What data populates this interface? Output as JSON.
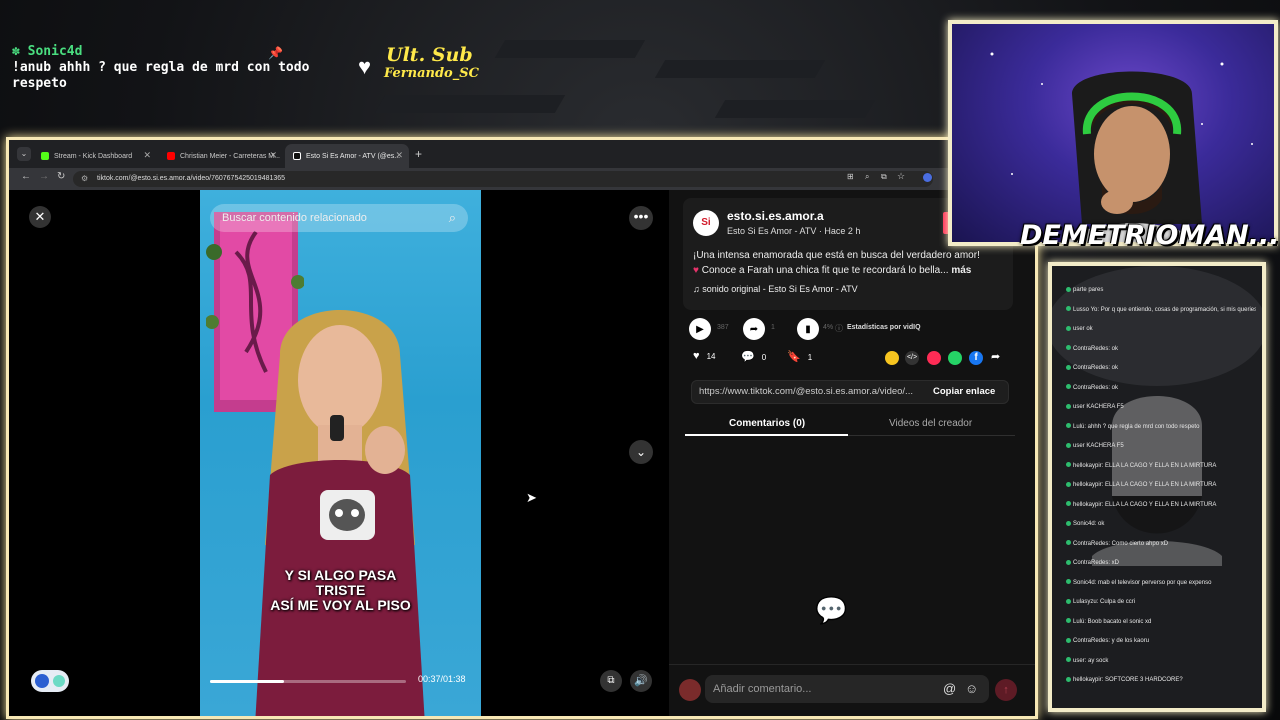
{
  "overlay": {
    "chat": {
      "user": "Sonic4d",
      "message": "!anub ahhh ? que regla de mrd con todo\nrespeto"
    },
    "ult_sub": {
      "title": "Ult. Sub",
      "name": "Fernando_SC"
    },
    "streamer_name": "DEMETRIOMAN...",
    "colors": {
      "frame": "#f3ecc8",
      "chat_user": "#4ade80",
      "ult_sub": "#ffe94a"
    }
  },
  "browser": {
    "tabs": [
      {
        "title": "Stream - Kick Dashboard",
        "icon_color": "#53fc18"
      },
      {
        "title": "Christian Meier - Carreteras M...",
        "icon_color": "#ff0000"
      },
      {
        "title": "Esto Si Es Amor - ATV (@es...",
        "icon_color": "#ffffff"
      }
    ],
    "url": "tiktok.com/@esto.si.es.amor.a/video/7607675425019481365"
  },
  "video": {
    "search_placeholder": "Buscar contenido relacionado",
    "caption_lines": [
      "Y SI ALGO PASA",
      "TRISTE",
      "ASÍ ME VOY AL PISO"
    ],
    "time": "00:37/01:38",
    "progress": 0.38
  },
  "post": {
    "username": "esto.si.es.amor.a",
    "subtitle": "Esto Si Es Amor - ATV · Hace 2 h",
    "avatar_text": "Si",
    "description_line1": "¡Una intensa enamorada que está en busca del verdadero amor!",
    "description_line2": "Conoce a Farah una chica fit que te recordará lo bella...",
    "more": "más",
    "sound": "sonido original - Esto Si Es Amor - ATV",
    "stat_play": "387",
    "stat_share": "1",
    "stat_pct": "4%",
    "stats_label": "Estadísticas por vidIQ",
    "likes": "14",
    "comments": "0",
    "saves": "1",
    "link_url": "https://www.tiktok.com/@esto.si.es.amor.a/video/...",
    "copy_link": "Copiar enlace",
    "tab_comments": "Comentarios (0)",
    "tab_videos": "Videos del creador",
    "comment_placeholder": "Añadir comentario..."
  },
  "right_chat": {
    "lines": [
      "parte pares",
      "Lusso Yo: Por q que entiendo, cosas de programación, si mis queries se producción no se deciden por Iber?",
      "user ok",
      "ContraRedes: ok",
      "ContraRedes: ok",
      "ContraRedes: ok",
      "user KACHERA F5",
      "Lulú: ahhh ? que regla de mrd con todo respeto",
      "user KACHERA F5",
      "hellokaypir: ELLA LA CAGO Y ELLA EN LA MIRTURA",
      "hellokaypir: ELLA LA CAGO Y ELLA EN LA MIRTURA",
      "hellokaypir: ELLA LA CAGO Y ELLA EN LA MIRTURA",
      "Sonic4d: ok",
      "ContraRedes: Como cierto ahpo xD",
      "ContraRedes: xD",
      "Sonic4d: mab el televisor perverso por que expenso",
      "Lulasyzu: Culpa de ccri",
      "Lulú: Boob bacato el sonic xd",
      "ContraRedes: y de los kaoru",
      "user: ay sock",
      "hellokaypir: SOFTCORE 3 HARDCORE?"
    ]
  }
}
